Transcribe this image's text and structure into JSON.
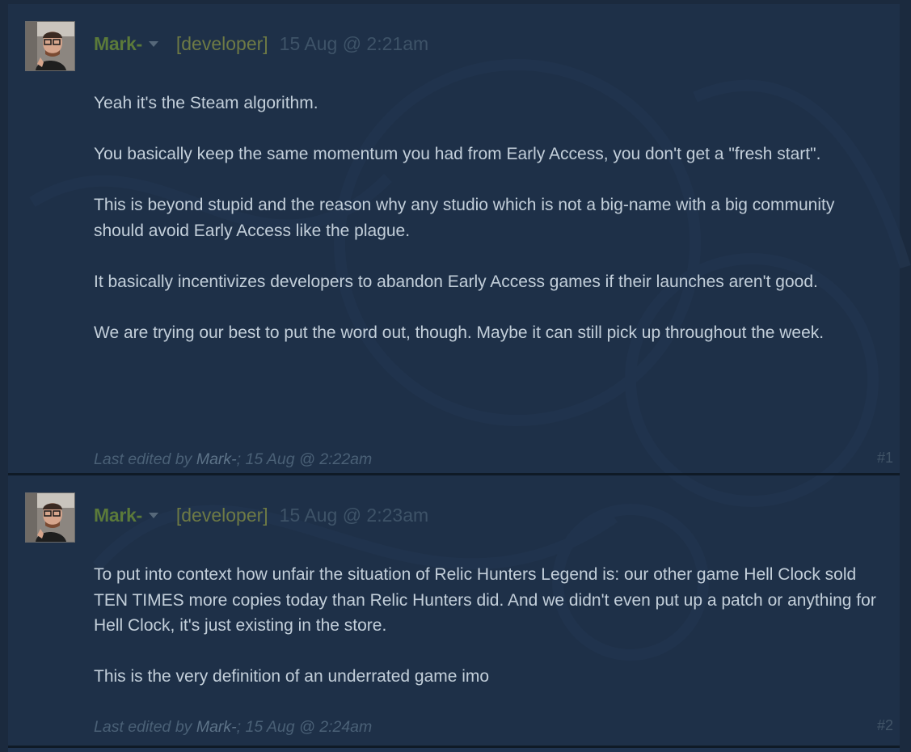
{
  "posts": [
    {
      "author": "Mark-",
      "tag": "[developer]",
      "timestamp": "15 Aug @ 2:21am",
      "paragraphs": [
        "Yeah it's the Steam algorithm.",
        "You basically keep the same momentum you had from Early Access, you don't get a \"fresh start\".",
        "This is beyond stupid and the reason why any studio which is not a big-name with a big community should avoid Early Access like the plague.",
        "It basically incentivizes developers to abandon Early Access games if their launches aren't good.",
        "We are trying our best to put the word out, though. Maybe it can still pick up throughout the week."
      ],
      "edited_prefix": "Last edited by ",
      "edited_by": "Mark-",
      "edited_suffix": "; 15 Aug @ 2:22am",
      "number": "#1"
    },
    {
      "author": "Mark-",
      "tag": "[developer]",
      "timestamp": "15 Aug @ 2:23am",
      "paragraphs": [
        "To put into context how unfair the situation of Relic Hunters Legend is: our other game Hell Clock sold TEN TIMES more copies today than Relic Hunters did. And we didn't even put up a patch or anything for Hell Clock, it's just existing in the store.",
        "This is the very definition of an underrated game imo"
      ],
      "edited_prefix": "Last edited by ",
      "edited_by": "Mark-",
      "edited_suffix": "; 15 Aug @ 2:24am",
      "number": "#2"
    }
  ],
  "icons": {
    "author_menu": "chevron-down-icon",
    "avatar": "avatar"
  },
  "colors": {
    "background": "#1d2c40",
    "author_name": "#5b7a3a",
    "developer_tag": "#6e7a45",
    "post_text": "#c3cfda",
    "timestamp": "#3e5368"
  }
}
